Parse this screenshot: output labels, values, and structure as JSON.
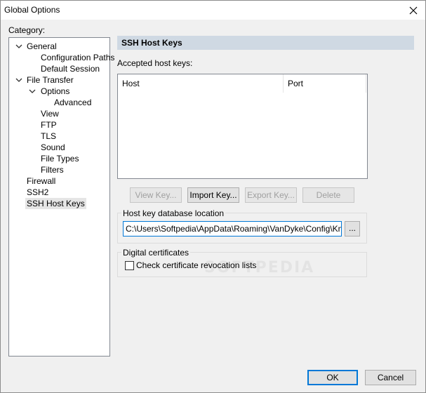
{
  "window": {
    "title": "Global Options"
  },
  "category": {
    "label": "Category:",
    "items": [
      {
        "label": "General"
      },
      {
        "label": "Configuration Paths"
      },
      {
        "label": "Default Session"
      },
      {
        "label": "File Transfer"
      },
      {
        "label": "Options"
      },
      {
        "label": "Advanced"
      },
      {
        "label": "View"
      },
      {
        "label": "FTP"
      },
      {
        "label": "TLS"
      },
      {
        "label": "Sound"
      },
      {
        "label": "File Types"
      },
      {
        "label": "Filters"
      },
      {
        "label": "Firewall"
      },
      {
        "label": "SSH2"
      },
      {
        "label": "SSH Host Keys"
      }
    ],
    "selected": "SSH Host Keys"
  },
  "panel": {
    "title": "SSH Host Keys",
    "accepted_label": "Accepted host keys:",
    "columns": [
      "Host",
      "Port"
    ],
    "buttons": {
      "view": "View Key...",
      "import": "Import Key...",
      "export": "Export Key...",
      "delete": "Delete"
    },
    "db_location": {
      "label": "Host key database location",
      "value": "C:\\Users\\Softpedia\\AppData\\Roaming\\VanDyke\\Config\\Known",
      "browse": "..."
    },
    "certificates": {
      "label": "Digital certificates",
      "check_label": "Check certificate revocation lists",
      "checked": false
    },
    "watermark": "SOFTPEDIA"
  },
  "footer": {
    "ok": "OK",
    "cancel": "Cancel"
  }
}
